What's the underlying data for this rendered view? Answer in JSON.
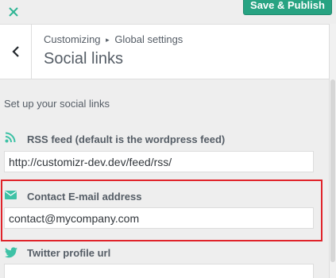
{
  "topbar": {
    "close_icon": "close-icon",
    "publish_label": "Save & Publish",
    "publish_color": "#27a382"
  },
  "header": {
    "breadcrumb_root": "Customizing",
    "breadcrumb_separator": "▸",
    "breadcrumb_section": "Global settings",
    "title": "Social links"
  },
  "description": "Set up your social links",
  "fields": {
    "rss": {
      "icon": "rss-icon",
      "label": "RSS feed (default is the wordpress feed)",
      "value": "http://customizr-dev.dev/feed/rss/"
    },
    "email": {
      "icon": "envelope-icon",
      "label": "Contact E-mail address",
      "value": "contact@mycompany.com"
    },
    "twitter": {
      "icon": "twitter-icon",
      "label": "Twitter profile url",
      "value": ""
    }
  },
  "accent_color": "#3ec2a6",
  "highlight_color": "#e0232a"
}
